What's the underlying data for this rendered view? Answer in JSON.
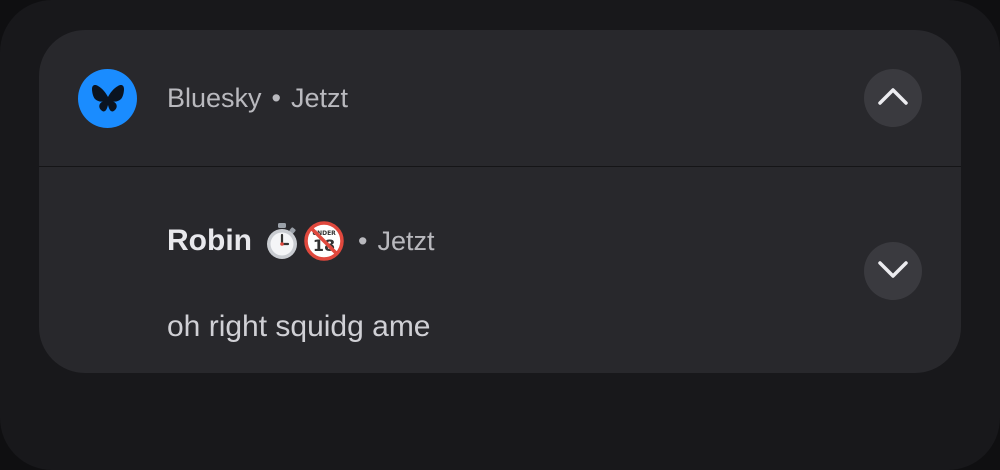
{
  "notification": {
    "app_name": "Bluesky",
    "separator": "•",
    "header_time": "Jetzt",
    "app_icon": "butterfly-icon",
    "brand_color": "#1a8cff",
    "collapse_icon": "chevron-up-icon",
    "expand_icon": "chevron-down-icon",
    "message": {
      "sender": "Robin",
      "sender_emojis": [
        "stopwatch-emoji",
        "no-one-under-eighteen-emoji"
      ],
      "time": "Jetzt",
      "text": "oh right squidg ame"
    }
  }
}
